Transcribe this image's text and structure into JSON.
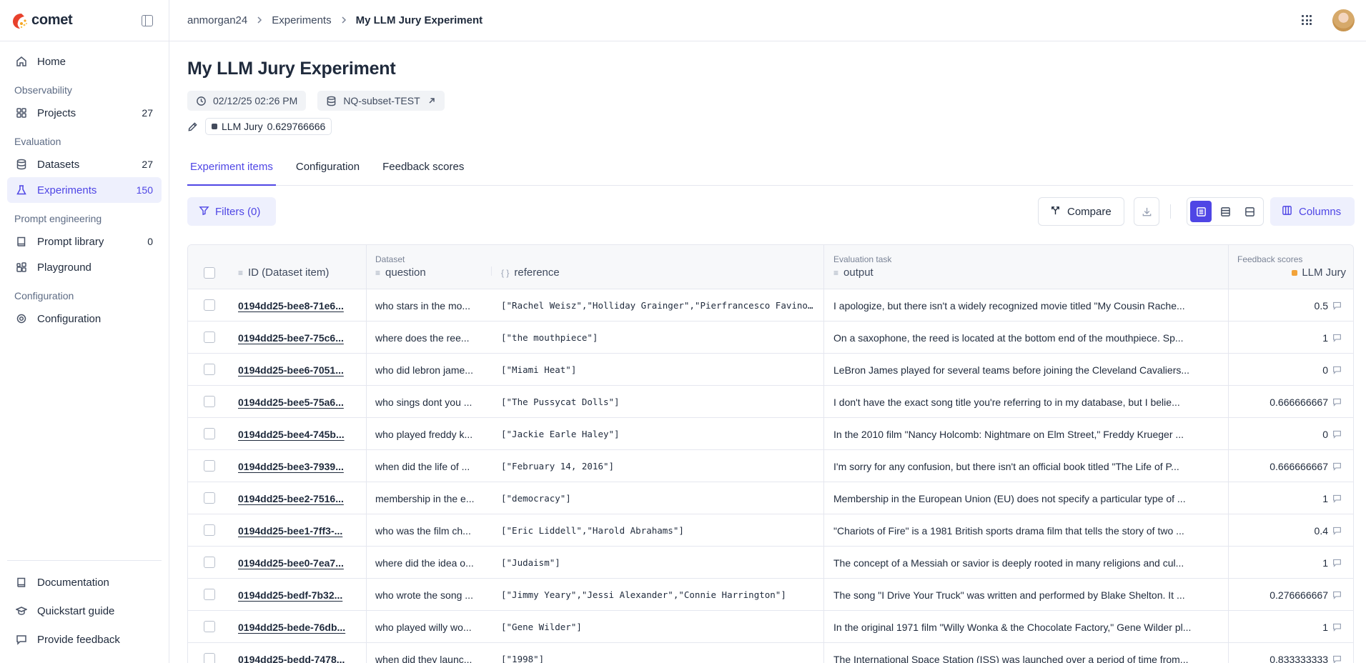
{
  "app": {
    "name": "comet"
  },
  "sidebar": {
    "home": "Home",
    "sections": [
      {
        "title": "Observability",
        "items": [
          {
            "label": "Projects",
            "count": "27"
          }
        ]
      },
      {
        "title": "Evaluation",
        "items": [
          {
            "label": "Datasets",
            "count": "27"
          },
          {
            "label": "Experiments",
            "count": "150"
          }
        ]
      },
      {
        "title": "Prompt engineering",
        "items": [
          {
            "label": "Prompt library",
            "count": "0"
          },
          {
            "label": "Playground",
            "count": ""
          }
        ]
      },
      {
        "title": "Configuration",
        "items": [
          {
            "label": "Configuration",
            "count": ""
          }
        ]
      }
    ],
    "footer": [
      {
        "label": "Documentation"
      },
      {
        "label": "Quickstart guide"
      },
      {
        "label": "Provide feedback"
      }
    ]
  },
  "breadcrumb": {
    "workspace": "anmorgan24",
    "section": "Experiments",
    "current": "My LLM Jury Experiment"
  },
  "experiment": {
    "title": "My LLM Jury Experiment",
    "created": "02/12/25 02:26 PM",
    "dataset": "NQ-subset-TEST",
    "score_name": "LLM Jury",
    "score_value": "0.629766666"
  },
  "tabs": [
    "Experiment items",
    "Configuration",
    "Feedback scores"
  ],
  "toolbar": {
    "filters": "Filters (0)",
    "compare": "Compare",
    "columns": "Columns"
  },
  "table": {
    "groups": {
      "dataset": "Dataset",
      "task": "Evaluation task",
      "feedback": "Feedback scores"
    },
    "columns": {
      "id": "ID (Dataset item)",
      "question": "question",
      "reference": "reference",
      "output": "output",
      "score": "LLM Jury"
    },
    "rows": [
      {
        "id": "0194dd25-bee8-71e6...",
        "question": "who stars in the mo...",
        "reference": "[\"Rachel Weisz\",\"Holliday Grainger\",\"Pierfrancesco Favino\",...",
        "output": "I apologize, but there isn't a widely recognized movie titled \"My Cousin Rache...",
        "score": "0.5"
      },
      {
        "id": "0194dd25-bee7-75c6...",
        "question": "where does the ree...",
        "reference": "[\"the mouthpiece\"]",
        "output": "On a saxophone, the reed is located at the bottom end of the mouthpiece. Sp...",
        "score": "1"
      },
      {
        "id": "0194dd25-bee6-7051...",
        "question": "who did lebron jame...",
        "reference": "[\"Miami Heat\"]",
        "output": "LeBron James played for several teams before joining the Cleveland Cavaliers...",
        "score": "0"
      },
      {
        "id": "0194dd25-bee5-75a6...",
        "question": "who sings dont you ...",
        "reference": "[\"The Pussycat Dolls\"]",
        "output": "I don't have the exact song title you're referring to in my database, but I belie...",
        "score": "0.666666667"
      },
      {
        "id": "0194dd25-bee4-745b...",
        "question": "who played freddy k...",
        "reference": "[\"Jackie Earle Haley\"]",
        "output": "In the 2010 film \"Nancy Holcomb: Nightmare on Elm Street,\" Freddy Krueger ...",
        "score": "0"
      },
      {
        "id": "0194dd25-bee3-7939...",
        "question": "when did the life of ...",
        "reference": "[\"February 14, 2016\"]",
        "output": "I'm sorry for any confusion, but there isn't an official book titled \"The Life of P...",
        "score": "0.666666667"
      },
      {
        "id": "0194dd25-bee2-7516...",
        "question": "membership in the e...",
        "reference": "[\"democracy\"]",
        "output": "Membership in the European Union (EU) does not specify a particular type of ...",
        "score": "1"
      },
      {
        "id": "0194dd25-bee1-7ff3-...",
        "question": "who was the film ch...",
        "reference": "[\"Eric Liddell\",\"Harold Abrahams\"]",
        "output": "\"Chariots of Fire\" is a 1981 British sports drama film that tells the story of two ...",
        "score": "0.4"
      },
      {
        "id": "0194dd25-bee0-7ea7...",
        "question": "where did the idea o...",
        "reference": "[\"Judaism\"]",
        "output": "The concept of a Messiah or savior is deeply rooted in many religions and cul...",
        "score": "1"
      },
      {
        "id": "0194dd25-bedf-7b32...",
        "question": "who wrote the song ...",
        "reference": "[\"Jimmy Yeary\",\"Jessi Alexander\",\"Connie Harrington\"]",
        "output": "The song \"I Drive Your Truck\" was written and performed by Blake Shelton. It ...",
        "score": "0.276666667"
      },
      {
        "id": "0194dd25-bede-76db...",
        "question": "who played willy wo...",
        "reference": "[\"Gene Wilder\"]",
        "output": "In the original 1971 film \"Willy Wonka & the Chocolate Factory,\" Gene Wilder pl...",
        "score": "1"
      },
      {
        "id": "0194dd25-bedd-7478...",
        "question": "when did they launc...",
        "reference": "[\"1998\"]",
        "output": "The International Space Station (ISS) was launched over a period of time from...",
        "score": "0.833333333"
      }
    ]
  },
  "colors": {
    "accent": "#4f46e5",
    "accent_bg": "#eef0fd",
    "llm_jury": "#f2a33a"
  },
  "icons": {
    "home": "home-icon",
    "projects": "grid-icon",
    "datasets": "database-icon",
    "experiments": "flask-icon",
    "prompt_library": "book-icon",
    "playground": "blocks-icon",
    "configuration": "gear-icon",
    "documentation": "book-icon",
    "quickstart": "graduation-cap-icon",
    "feedback": "message-icon"
  }
}
